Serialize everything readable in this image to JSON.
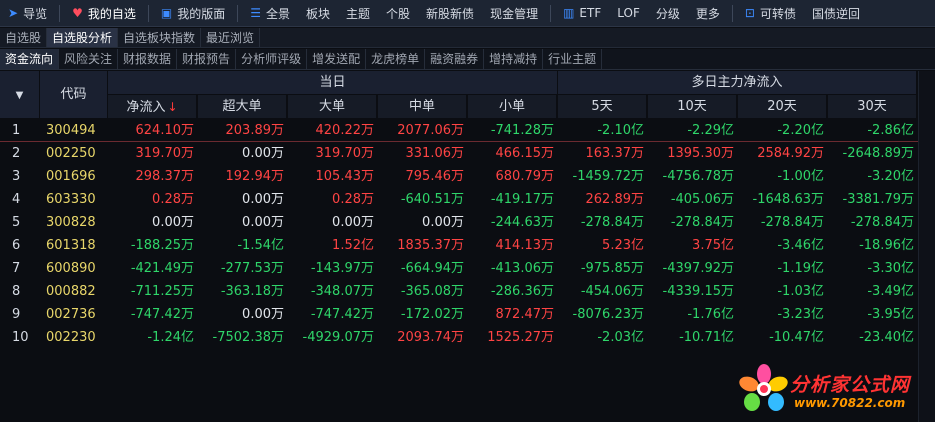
{
  "topnav": [
    {
      "icon": "send-icon",
      "label": "导览"
    },
    {
      "icon": "heart-icon",
      "label": "我的自选",
      "active": true
    },
    {
      "icon": "board-icon",
      "label": "我的版面"
    },
    {
      "icon": "list-icon",
      "label": "全景"
    },
    {
      "label": "板块"
    },
    {
      "label": "主题"
    },
    {
      "label": "个股"
    },
    {
      "label": "新股新债"
    },
    {
      "label": "现金管理"
    },
    {
      "icon": "chart-icon",
      "label": "ETF"
    },
    {
      "label": "LOF"
    },
    {
      "label": "分级"
    },
    {
      "label": "更多"
    },
    {
      "icon": "bond-icon",
      "label": "可转债"
    },
    {
      "label": "国债逆回"
    }
  ],
  "tabs2": [
    {
      "label": "自选股"
    },
    {
      "label": "自选股分析",
      "active": true
    },
    {
      "label": "自选板块指数"
    },
    {
      "label": "最近浏览"
    }
  ],
  "tabs3": [
    {
      "label": "资金流向",
      "active": true
    },
    {
      "label": "风险关注"
    },
    {
      "label": "财报数据"
    },
    {
      "label": "财报预告"
    },
    {
      "label": "分析师评级"
    },
    {
      "label": "增发送配"
    },
    {
      "label": "龙虎榜单"
    },
    {
      "label": "融资融券"
    },
    {
      "label": "增持减持"
    },
    {
      "label": "行业主题"
    }
  ],
  "table": {
    "code_header": "代码",
    "group_today": "当日",
    "group_multi": "多日主力净流入",
    "sort_arrow": "↓",
    "columns": [
      "净流入",
      "超大单",
      "大单",
      "中单",
      "小单",
      "5天",
      "10天",
      "20天",
      "30天"
    ],
    "rows": [
      {
        "idx": "1",
        "code": "300494",
        "vals": [
          "624.10万",
          "203.89万",
          "420.22万",
          "2077.06万",
          "-741.28万",
          "-2.10亿",
          "-2.29亿",
          "-2.20亿",
          "-2.86亿"
        ]
      },
      {
        "idx": "2",
        "code": "002250",
        "vals": [
          "319.70万",
          "0.00万",
          "319.70万",
          "331.06万",
          "466.15万",
          "163.37万",
          "1395.30万",
          "2584.92万",
          "-2648.89万"
        ]
      },
      {
        "idx": "3",
        "code": "001696",
        "vals": [
          "298.37万",
          "192.94万",
          "105.43万",
          "795.46万",
          "680.79万",
          "-1459.72万",
          "-4756.78万",
          "-1.00亿",
          "-3.20亿"
        ]
      },
      {
        "idx": "4",
        "code": "603330",
        "vals": [
          "0.28万",
          "0.00万",
          "0.28万",
          "-640.51万",
          "-419.17万",
          "262.89万",
          "-405.06万",
          "-1648.63万",
          "-3381.79万"
        ]
      },
      {
        "idx": "5",
        "code": "300828",
        "vals": [
          "0.00万",
          "0.00万",
          "0.00万",
          "0.00万",
          "-244.63万",
          "-278.84万",
          "-278.84万",
          "-278.84万",
          "-278.84万"
        ]
      },
      {
        "idx": "6",
        "code": "601318",
        "vals": [
          "-188.25万",
          "-1.54亿",
          "1.52亿",
          "1835.37万",
          "414.13万",
          "5.23亿",
          "3.75亿",
          "-3.46亿",
          "-18.96亿"
        ]
      },
      {
        "idx": "7",
        "code": "600890",
        "vals": [
          "-421.49万",
          "-277.53万",
          "-143.97万",
          "-664.94万",
          "-413.06万",
          "-975.85万",
          "-4397.92万",
          "-1.19亿",
          "-3.30亿"
        ]
      },
      {
        "idx": "8",
        "code": "000882",
        "vals": [
          "-711.25万",
          "-363.18万",
          "-348.07万",
          "-365.08万",
          "-286.36万",
          "-454.06万",
          "-4339.15万",
          "-1.03亿",
          "-3.49亿"
        ]
      },
      {
        "idx": "9",
        "code": "002736",
        "vals": [
          "-747.42万",
          "0.00万",
          "-747.42万",
          "-172.02万",
          "872.47万",
          "-8076.23万",
          "-1.76亿",
          "-3.23亿",
          "-3.95亿"
        ]
      },
      {
        "idx": "10",
        "code": "002230",
        "vals": [
          "-1.24亿",
          "-7502.38万",
          "-4929.07万",
          "2093.74万",
          "1525.27万",
          "-2.03亿",
          "-10.71亿",
          "-10.47亿",
          "-23.40亿"
        ]
      }
    ]
  },
  "watermark": {
    "title": "分析家公式网",
    "url": "www.70822.com"
  },
  "colors": {
    "positive": "#ff4444",
    "negative": "#2fd66a",
    "zero": "#e2e6ec",
    "code": "#e8d66a"
  }
}
